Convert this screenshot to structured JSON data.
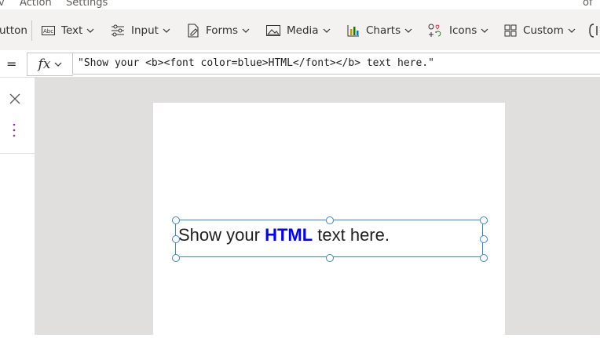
{
  "menu": {
    "items": [
      "v",
      "Action",
      "Settings"
    ],
    "right_text": "of C"
  },
  "ribbon": {
    "partial_item": "utton",
    "items": [
      {
        "label": "Text",
        "icon": "text-box-icon"
      },
      {
        "label": "Input",
        "icon": "sliders-icon"
      },
      {
        "label": "Forms",
        "icon": "form-edit-icon"
      },
      {
        "label": "Media",
        "icon": "image-icon"
      },
      {
        "label": "Charts",
        "icon": "bar-chart-icon"
      },
      {
        "label": "Icons",
        "icon": "shapes-icon"
      },
      {
        "label": "Custom",
        "icon": "custom-component-icon"
      }
    ]
  },
  "formula_bar": {
    "equals": "=",
    "fx": "fx",
    "formula": "\"Show your <b><font color=blue>HTML</font></b> text here.\""
  },
  "canvas": {
    "html_text": {
      "before": "Show your ",
      "bold": "HTML",
      "after": " text here.",
      "bold_color": "#0000ff"
    }
  },
  "colors": {
    "selection": "#3b86d4",
    "rail_dots": "#8a3c97",
    "canvas_bg": "#e1dfdd"
  }
}
